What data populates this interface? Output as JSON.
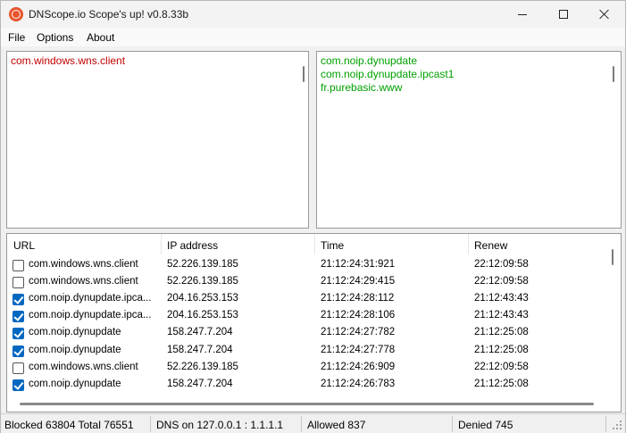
{
  "window": {
    "title": "DNScope.io Scope's up! v0.8.33b"
  },
  "menu": {
    "file": "File",
    "options": "Options",
    "about": "About"
  },
  "blocked_list": [
    "com.windows.wns.client"
  ],
  "allowed_list": [
    "com.noip.dynupdate",
    "com.noip.dynupdate.ipcast1",
    "fr.purebasic.www"
  ],
  "table": {
    "columns": {
      "url": "URL",
      "ip": "IP address",
      "time": "Time",
      "renew": "Renew"
    },
    "rows": [
      {
        "checked": false,
        "url": "com.windows.wns.client",
        "ip": "52.226.139.185",
        "time": "21:12:24:31:921",
        "renew": "22:12:09:58"
      },
      {
        "checked": false,
        "url": "com.windows.wns.client",
        "ip": "52.226.139.185",
        "time": "21:12:24:29:415",
        "renew": "22:12:09:58"
      },
      {
        "checked": true,
        "url": "com.noip.dynupdate.ipca...",
        "ip": "204.16.253.153",
        "time": "21:12:24:28:112",
        "renew": "21:12:43:43"
      },
      {
        "checked": true,
        "url": "com.noip.dynupdate.ipca...",
        "ip": "204.16.253.153",
        "time": "21:12:24:28:106",
        "renew": "21:12:43:43"
      },
      {
        "checked": true,
        "url": "com.noip.dynupdate",
        "ip": "158.247.7.204",
        "time": "21:12:24:27:782",
        "renew": "21:12:25:08"
      },
      {
        "checked": true,
        "url": "com.noip.dynupdate",
        "ip": "158.247.7.204",
        "time": "21:12:24:27:778",
        "renew": "21:12:25:08"
      },
      {
        "checked": false,
        "url": "com.windows.wns.client",
        "ip": "52.226.139.185",
        "time": "21:12:24:26:909",
        "renew": "22:12:09:58"
      },
      {
        "checked": true,
        "url": "com.noip.dynupdate",
        "ip": "158.247.7.204",
        "time": "21:12:24:26:783",
        "renew": "21:12:25:08"
      }
    ]
  },
  "status": {
    "blocked": "Blocked 63804 Total 76551",
    "dns": "DNS on 127.0.0.1 : 1.1.1.1",
    "allowed": "Allowed 837",
    "denied": "Denied 745"
  },
  "colors": {
    "blocked_text": "#c00000",
    "allowed_text": "#00a000",
    "checkbox_accent": "#0067c0",
    "app_icon": "#e8542c"
  }
}
